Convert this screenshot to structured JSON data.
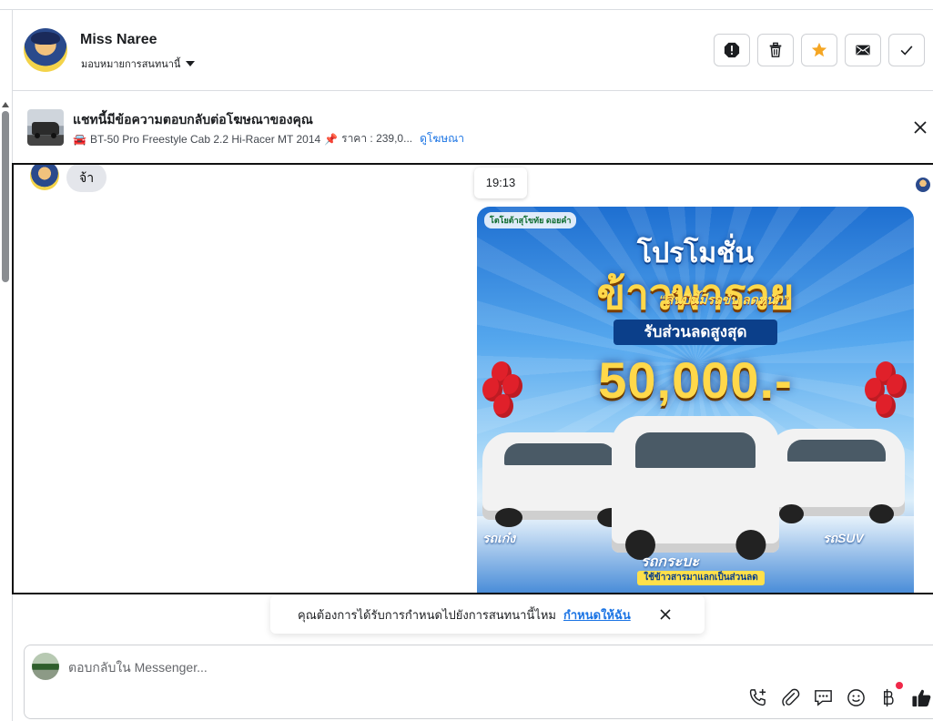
{
  "header": {
    "contact_name": "Miss Naree",
    "assign_label": "มอบหมายการสนทนานี้",
    "actions": [
      "report",
      "delete",
      "star",
      "mark-unread",
      "mark-done"
    ]
  },
  "ad_context": {
    "title": "แชทนี้มีข้อความตอบกลับต่อโฆษณาของคุณ",
    "car_emoji": "🚘",
    "listing": "BT-50 Pro Freestyle Cab 2.2 Hi-Racer MT 2014",
    "pin_emoji": "📌",
    "price": "ราคา : 239,0...",
    "view_ad_link": "ดูโฆษณา"
  },
  "chat": {
    "incoming_message": "จ้า",
    "timestamp": "19:13",
    "promo": {
      "brand": "โตโยต้าสุโขทัย ดอยคำ",
      "headline": "โปรโมชั่น",
      "title": "ข้าวพารวย",
      "tagline": "“สิ้นปีนี้มีรถขับ ลดหนัก”",
      "ribbon": "รับส่วนลดสูงสุด",
      "amount": "50,000.-",
      "label_left": "รถเก๋ง",
      "label_mid": "รถกระบะ",
      "label_right": "รถSUV",
      "note": "ใช้ข้าวสารมาแลกเป็นส่วนลด"
    }
  },
  "assign_prompt": {
    "text": "คุณต้องการได้รับการกำหนดไปยังการสนทนานี้ไหม",
    "link": "กำหนดให้ฉัน"
  },
  "composer": {
    "placeholder": "ตอบกลับใน Messenger..."
  },
  "colors": {
    "accent": "#1b74e4",
    "star": "#f5a623",
    "bubble": "#e4e6eb",
    "notification": "#f02849"
  }
}
